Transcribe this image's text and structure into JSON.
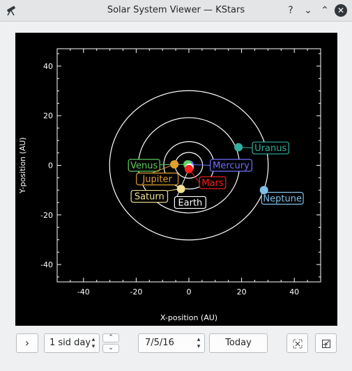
{
  "window": {
    "title": "Solar System Viewer — KStars"
  },
  "titlebar": {
    "help": "?",
    "minimize": "⌄",
    "maximize": "⌃",
    "close": "✕"
  },
  "chart_data": {
    "type": "scatter",
    "xlabel": "X-position (AU)",
    "ylabel": "Y-position (AU)",
    "xlim": [
      -50,
      50
    ],
    "ylim": [
      -47,
      47
    ],
    "xticks": [
      -40,
      -20,
      0,
      20,
      40
    ],
    "yticks": [
      40,
      20,
      0,
      -20,
      -40
    ],
    "orbits_au": [
      0.39,
      0.72,
      1.0,
      1.52,
      5.2,
      9.54,
      19.2,
      30.1
    ],
    "sun": {
      "x": 0,
      "y": 0,
      "color": "#ffff80"
    },
    "planets": [
      {
        "name": "Mercury",
        "x": 0.2,
        "y": 0.3,
        "color": "#7070ff",
        "label_x": 16,
        "label_y": 0
      },
      {
        "name": "Venus",
        "x": -0.5,
        "y": 0.4,
        "color": "#60d060",
        "label_x": -17,
        "label_y": 0
      },
      {
        "name": "Earth",
        "x": 0.2,
        "y": -0.9,
        "color": "#ffffff",
        "label_x": 0.5,
        "label_y": -15
      },
      {
        "name": "Mars",
        "x": 0.0,
        "y": -1.5,
        "color": "#ff2020",
        "label_x": 9,
        "label_y": -7
      },
      {
        "name": "Jupiter",
        "x": -5.5,
        "y": 0.4,
        "color": "#e0a030",
        "label_x": -12,
        "label_y": -5.5
      },
      {
        "name": "Saturn",
        "x": -3.0,
        "y": -9.5,
        "color": "#f0e090",
        "label_x": -15,
        "label_y": -12.5
      },
      {
        "name": "Uranus",
        "x": 18.8,
        "y": 7.3,
        "color": "#30b0a0",
        "label_x": 31,
        "label_y": 7
      },
      {
        "name": "Neptune",
        "x": 28.5,
        "y": -10.0,
        "color": "#80c0e8",
        "label_x": 35.5,
        "label_y": -13.3
      }
    ]
  },
  "controls": {
    "step_value": "1 sid day",
    "date_value": "7/5/16",
    "today_label": "Today",
    "next_icon": "›",
    "spin_up": "▴",
    "spin_down": "▾",
    "rate_up": "⌃",
    "rate_down": "⌄"
  },
  "icons": {
    "app": "telescope-icon",
    "zoom_in": "zoom-in-icon",
    "zoom_out": "zoom-out-icon"
  }
}
